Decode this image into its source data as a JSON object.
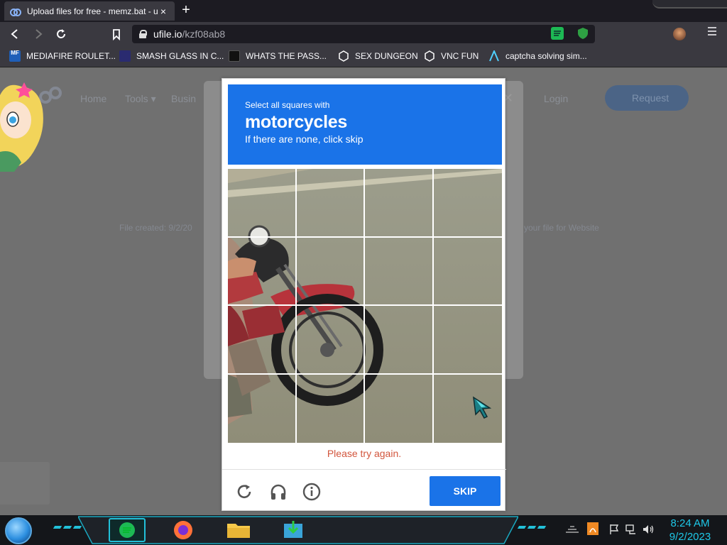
{
  "browser": {
    "tab_title": "Upload files for free - memz.bat - ufile.io",
    "tab_close": "×",
    "new_tab": "+",
    "url_domain": "ufile.io",
    "url_path": "/kzf08ab8",
    "bookmarks": [
      {
        "label": "MEDIAFIRE ROULET...",
        "icon": "mediafire-icon"
      },
      {
        "label": "SMASH GLASS IN C...",
        "icon": "visual-studio-icon"
      },
      {
        "label": "WHATS THE PASS...",
        "icon": "bookmark-icon"
      },
      {
        "label": "SEX DUNGEON",
        "icon": "unity-icon"
      },
      {
        "label": "VNC FUN",
        "icon": "unity-icon"
      },
      {
        "label": "captcha solving sim...",
        "icon": "arrow-logo-icon"
      }
    ]
  },
  "site": {
    "nav": [
      "Home",
      "Tools ▾",
      "Busin"
    ],
    "login": "Login",
    "request": "Request",
    "created_left": "File created: 9/2/20",
    "created_right": "your file for Website"
  },
  "captcha": {
    "instruction": "Select all squares with",
    "target": "motorcycles",
    "hint": "If there are none, click skip",
    "error": "Please try again.",
    "skip_label": "SKIP",
    "grid_size": 4
  },
  "taskbar": {
    "time": "8:24 AM",
    "date": "9/2/2023",
    "apps": [
      "spotify-icon",
      "firefox-icon",
      "file-explorer-icon",
      "download-icon"
    ]
  },
  "colors": {
    "captcha_blue": "#1a73e8",
    "error_red": "#d2553c",
    "clock_cyan": "#1ec8e8"
  }
}
